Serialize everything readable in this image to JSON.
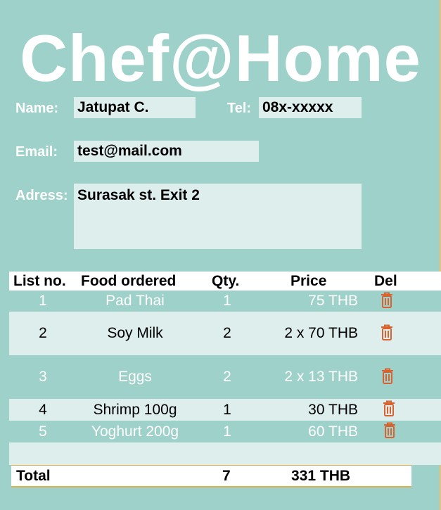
{
  "app": {
    "title": "Chef@Home"
  },
  "form": {
    "name_label": "Name:",
    "name_value": "Jatupat C.",
    "tel_label": "Tel:",
    "tel_value": "08x-xxxxx",
    "email_label": "Email:",
    "email_value": "test@mail.com",
    "address_label": "Adress:",
    "address_value": "Surasak st. Exit 2"
  },
  "table": {
    "headers": {
      "list_no": "List no.",
      "food": "Food ordered",
      "qty": "Qty.",
      "price": "Price",
      "del": "Del"
    },
    "rows": [
      {
        "no": "1",
        "food": "Pad Thai",
        "qty": "1",
        "price": "75 THB"
      },
      {
        "no": "2",
        "food": "Soy Milk",
        "qty": "2",
        "price": "2 x 70 THB"
      },
      {
        "no": "3",
        "food": "Eggs",
        "qty": "2",
        "price": "2 x 13 THB"
      },
      {
        "no": "4",
        "food": "Shrimp 100g",
        "qty": "1",
        "price": "30 THB"
      },
      {
        "no": "5",
        "food": "Yoghurt 200g",
        "qty": "1",
        "price": "60 THB"
      }
    ],
    "total": {
      "label": "Total",
      "qty": "7",
      "price": "331 THB"
    }
  },
  "colors": {
    "background": "#9dd1c9",
    "field_fill": "#ddeeed",
    "trash_icon": "#d9632e",
    "row_text_light": "#ffffff",
    "row_text_dark": "#000000"
  },
  "icons": {
    "delete": "trash-icon"
  }
}
